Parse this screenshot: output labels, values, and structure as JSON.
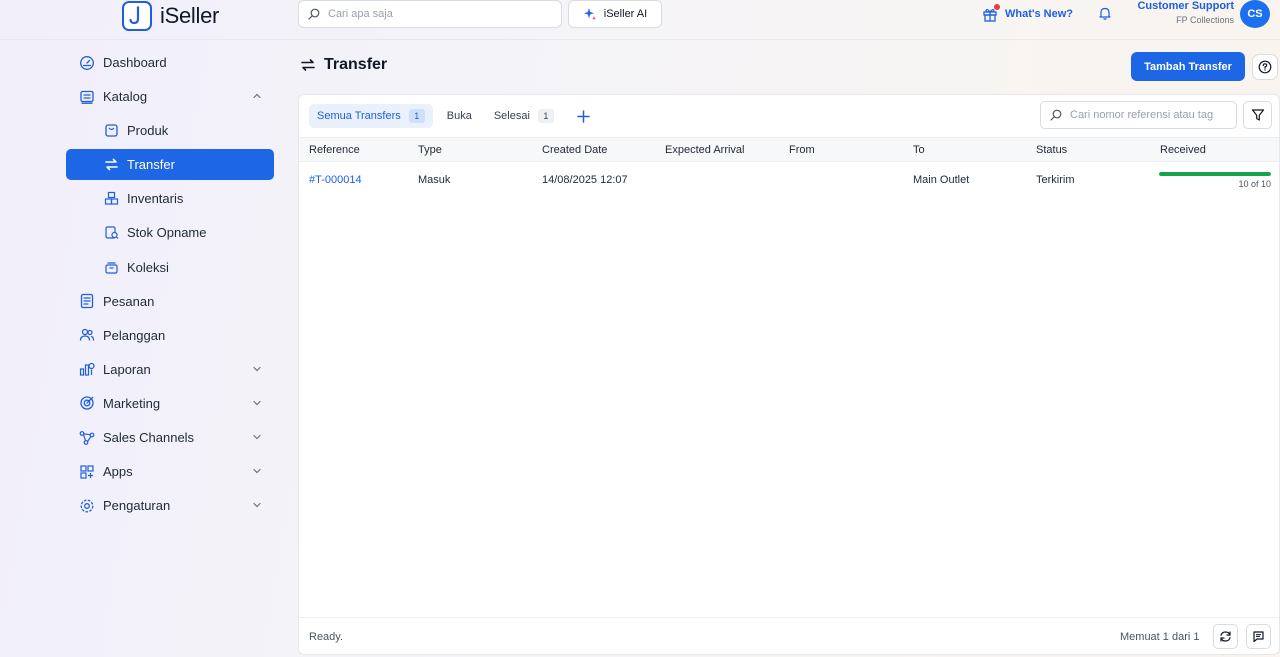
{
  "app": {
    "name": "iSeller"
  },
  "topbar": {
    "search_placeholder": "Cari apa saja",
    "ai_button": "iSeller AI",
    "whats_new": "What's New?",
    "user_name": "Customer Support",
    "user_org": "FP Collections",
    "user_initials": "CS"
  },
  "sidebar": {
    "items": [
      {
        "label": "Dashboard",
        "icon": "dashboard-icon"
      },
      {
        "label": "Katalog",
        "icon": "catalog-icon",
        "expanded": true
      },
      {
        "label": "Produk",
        "icon": "product-icon"
      },
      {
        "label": "Transfer",
        "icon": "transfer-icon",
        "active": true
      },
      {
        "label": "Inventaris",
        "icon": "inventory-icon"
      },
      {
        "label": "Stok Opname",
        "icon": "stock-opname-icon"
      },
      {
        "label": "Koleksi",
        "icon": "collection-icon"
      },
      {
        "label": "Pesanan",
        "icon": "orders-icon"
      },
      {
        "label": "Pelanggan",
        "icon": "customers-icon"
      },
      {
        "label": "Laporan",
        "icon": "reports-icon"
      },
      {
        "label": "Marketing",
        "icon": "marketing-icon"
      },
      {
        "label": "Sales Channels",
        "icon": "sales-channels-icon"
      },
      {
        "label": "Apps",
        "icon": "apps-icon"
      },
      {
        "label": "Pengaturan",
        "icon": "settings-icon"
      }
    ]
  },
  "page": {
    "title": "Transfer",
    "add_button": "Tambah Transfer"
  },
  "tabs": [
    {
      "label": "Semua Transfers",
      "count": "1",
      "active": true
    },
    {
      "label": "Buka",
      "count": ""
    },
    {
      "label": "Selesai",
      "count": "1"
    }
  ],
  "table": {
    "search_placeholder": "Cari nomor referensi atau tag",
    "columns": [
      "Reference",
      "Type",
      "Created Date",
      "Expected Arrival",
      "From",
      "To",
      "Status",
      "Received"
    ],
    "rows": [
      {
        "reference": "#T-000014",
        "type": "Masuk",
        "created_date": "14/08/2025 12:07",
        "expected_arrival": "",
        "from": "",
        "to": "Main Outlet",
        "status": "Terkirim",
        "received_text": "10 of 10",
        "received_fraction": 1.0
      }
    ]
  },
  "footer": {
    "status": "Ready.",
    "paging": "Memuat 1 dari 1"
  },
  "colors": {
    "primary": "#1d66e5",
    "progress": "#17a34a",
    "link": "#1d5fe0"
  }
}
